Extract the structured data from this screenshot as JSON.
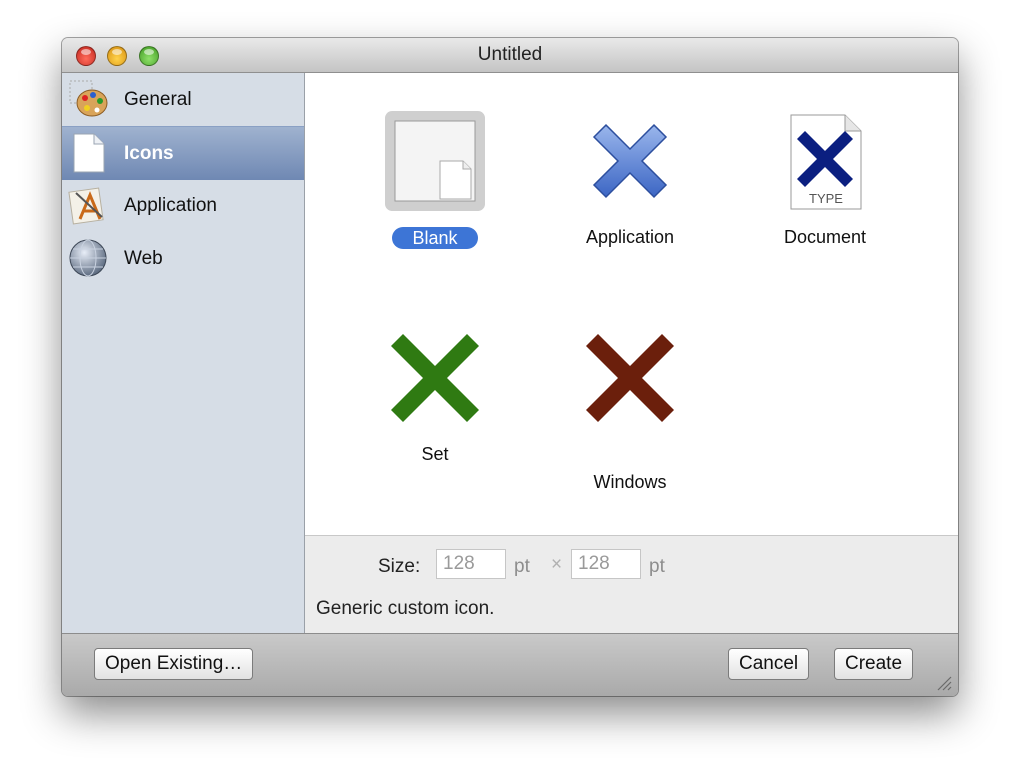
{
  "window": {
    "title": "Untitled"
  },
  "sidebar": {
    "items": [
      {
        "label": "General",
        "icon": "palette-icon"
      },
      {
        "label": "Icons",
        "icon": "blank-document-icon",
        "selected": true
      },
      {
        "label": "Application",
        "icon": "app-icon"
      },
      {
        "label": "Web",
        "icon": "globe-icon"
      }
    ]
  },
  "templates": [
    {
      "label": "Blank",
      "icon": "blank-icon",
      "selected": true
    },
    {
      "label": "Application",
      "icon": "blue-x-icon",
      "color": "#4a78d0"
    },
    {
      "label": "Document",
      "icon": "document-x-icon",
      "badge": "TYPE",
      "color": "#0b1f80"
    },
    {
      "label": "Set",
      "icon": "green-x-icon",
      "color": "#2f7a12"
    },
    {
      "label": "Windows",
      "icon": "red-x-icon",
      "color": "#6b1f0c"
    }
  ],
  "info": {
    "size_label": "Size:",
    "width": "128",
    "height": "128",
    "unit": "pt",
    "times": "×",
    "description": "Generic custom icon."
  },
  "buttons": {
    "open_existing": "Open Existing…",
    "cancel": "Cancel",
    "create": "Create"
  }
}
